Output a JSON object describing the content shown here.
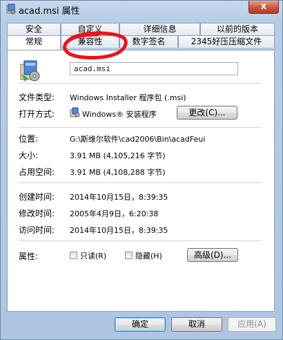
{
  "window": {
    "title": "acad.msi 属性",
    "close_glyph": "x"
  },
  "tabs": {
    "back_row": [
      "安全",
      "自定义",
      "详细信息",
      "以前的版本"
    ],
    "front_row": [
      "常规",
      "兼容性",
      "数字签名",
      "2345好压压缩文件"
    ],
    "active": "常规"
  },
  "general": {
    "file_name": "acad.msi",
    "type_label": "文件类型:",
    "type_value": "Windows Installer 程序包 (.msi)",
    "opens_with_label": "打开方式:",
    "opens_with_value": "Windows® 安装程序",
    "change_button": "更改(C)...",
    "location_label": "位置:",
    "location_value": "G:\\斯维尔软件\\cad2006\\Bin\\acadFeui",
    "size_label": "大小:",
    "size_value": "3.91 MB (4,105,216 字节)",
    "size_on_disk_label": "占用空间:",
    "size_on_disk_value": "3.91 MB (4,108,288 字节)",
    "created_label": "创建时间:",
    "created_value": "2014年10月15日，8:39:35",
    "modified_label": "修改时间:",
    "modified_value": "2005年4月9日，6:20:38",
    "accessed_label": "访问时间:",
    "accessed_value": "2014年10月15日，8:39:35",
    "attributes_label": "属性:",
    "readonly_label": "只读(R)",
    "hidden_label": "隐藏(H)",
    "advanced_button": "高级(D)..."
  },
  "footer": {
    "ok": "确定",
    "cancel": "取消",
    "apply": "应用(A)"
  },
  "colors": {
    "title_bg": "#c6d9ee",
    "close_red": "#c9543d",
    "annotation_red": "#e8141c",
    "panel_border": "#8c9fb6"
  }
}
